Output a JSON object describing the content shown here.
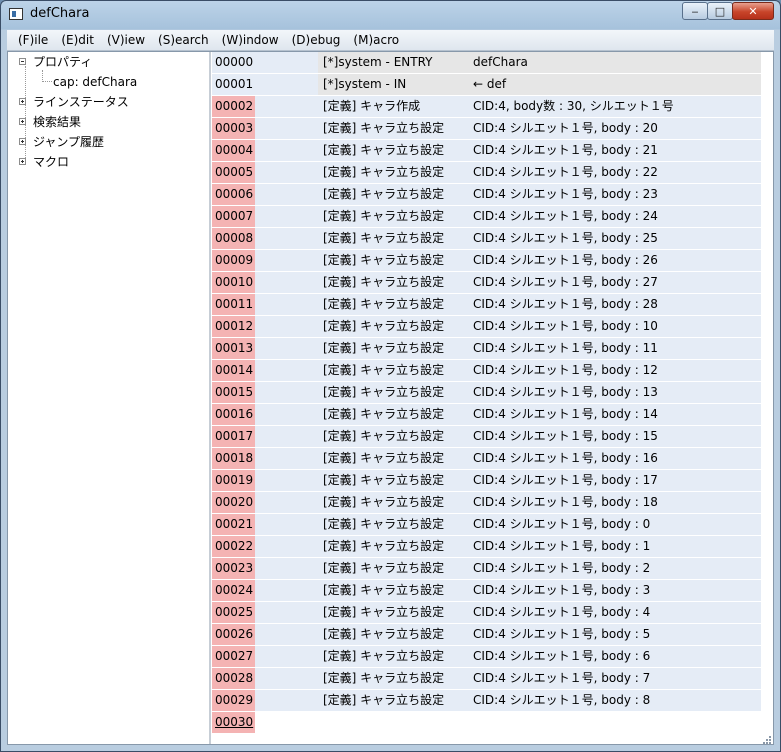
{
  "window": {
    "title": "defChara",
    "buttons": {
      "minimize": "‒",
      "maximize": "□",
      "close": "✕"
    }
  },
  "menu": [
    "(F)ile",
    "(E)dit",
    "(V)iew",
    "(S)earch",
    "(W)indow",
    "(D)ebug",
    "(M)acro"
  ],
  "tree": {
    "properties": "プロパティ",
    "cap": "cap: defChara",
    "line_status": "ラインステータス",
    "search_results": "検索結果",
    "jump_history": "ジャンプ履歴",
    "macro": "マクロ"
  },
  "rows": [
    {
      "num": "00000",
      "cmd": "[*]system -  ENTRY",
      "arg": "defChara",
      "kind": "sys"
    },
    {
      "num": "00001",
      "cmd": "[*]system -  IN",
      "arg": "← def",
      "kind": "sys"
    },
    {
      "num": "00002",
      "cmd": "[定義] キャラ作成",
      "arg": "CID:4, body数 : 30, シルエット１号",
      "kind": "def"
    },
    {
      "num": "00003",
      "cmd": "[定義] キャラ立ち設定",
      "arg": "CID:4 シルエット１号, body : 20",
      "kind": "def"
    },
    {
      "num": "00004",
      "cmd": "[定義] キャラ立ち設定",
      "arg": "CID:4 シルエット１号, body : 21",
      "kind": "def"
    },
    {
      "num": "00005",
      "cmd": "[定義] キャラ立ち設定",
      "arg": "CID:4 シルエット１号, body : 22",
      "kind": "def"
    },
    {
      "num": "00006",
      "cmd": "[定義] キャラ立ち設定",
      "arg": "CID:4 シルエット１号, body : 23",
      "kind": "def"
    },
    {
      "num": "00007",
      "cmd": "[定義] キャラ立ち設定",
      "arg": "CID:4 シルエット１号, body : 24",
      "kind": "def"
    },
    {
      "num": "00008",
      "cmd": "[定義] キャラ立ち設定",
      "arg": "CID:4 シルエット１号, body : 25",
      "kind": "def"
    },
    {
      "num": "00009",
      "cmd": "[定義] キャラ立ち設定",
      "arg": "CID:4 シルエット１号, body : 26",
      "kind": "def"
    },
    {
      "num": "00010",
      "cmd": "[定義] キャラ立ち設定",
      "arg": "CID:4 シルエット１号, body : 27",
      "kind": "def"
    },
    {
      "num": "00011",
      "cmd": "[定義] キャラ立ち設定",
      "arg": "CID:4 シルエット１号, body : 28",
      "kind": "def"
    },
    {
      "num": "00012",
      "cmd": "[定義] キャラ立ち設定",
      "arg": "CID:4 シルエット１号, body : 10",
      "kind": "def"
    },
    {
      "num": "00013",
      "cmd": "[定義] キャラ立ち設定",
      "arg": "CID:4 シルエット１号, body : 11",
      "kind": "def"
    },
    {
      "num": "00014",
      "cmd": "[定義] キャラ立ち設定",
      "arg": "CID:4 シルエット１号, body : 12",
      "kind": "def"
    },
    {
      "num": "00015",
      "cmd": "[定義] キャラ立ち設定",
      "arg": "CID:4 シルエット１号, body : 13",
      "kind": "def"
    },
    {
      "num": "00016",
      "cmd": "[定義] キャラ立ち設定",
      "arg": "CID:4 シルエット１号, body : 14",
      "kind": "def"
    },
    {
      "num": "00017",
      "cmd": "[定義] キャラ立ち設定",
      "arg": "CID:4 シルエット１号, body : 15",
      "kind": "def"
    },
    {
      "num": "00018",
      "cmd": "[定義] キャラ立ち設定",
      "arg": "CID:4 シルエット１号, body : 16",
      "kind": "def"
    },
    {
      "num": "00019",
      "cmd": "[定義] キャラ立ち設定",
      "arg": "CID:4 シルエット１号, body : 17",
      "kind": "def"
    },
    {
      "num": "00020",
      "cmd": "[定義] キャラ立ち設定",
      "arg": "CID:4 シルエット１号, body : 18",
      "kind": "def"
    },
    {
      "num": "00021",
      "cmd": "[定義] キャラ立ち設定",
      "arg": "CID:4 シルエット１号, body : 0",
      "kind": "def"
    },
    {
      "num": "00022",
      "cmd": "[定義] キャラ立ち設定",
      "arg": "CID:4 シルエット１号, body : 1",
      "kind": "def"
    },
    {
      "num": "00023",
      "cmd": "[定義] キャラ立ち設定",
      "arg": "CID:4 シルエット１号, body : 2",
      "kind": "def"
    },
    {
      "num": "00024",
      "cmd": "[定義] キャラ立ち設定",
      "arg": "CID:4 シルエット１号, body : 3",
      "kind": "def"
    },
    {
      "num": "00025",
      "cmd": "[定義] キャラ立ち設定",
      "arg": "CID:4 シルエット１号, body : 4",
      "kind": "def"
    },
    {
      "num": "00026",
      "cmd": "[定義] キャラ立ち設定",
      "arg": "CID:4 シルエット１号, body : 5",
      "kind": "def"
    },
    {
      "num": "00027",
      "cmd": "[定義] キャラ立ち設定",
      "arg": "CID:4 シルエット１号, body : 6",
      "kind": "def"
    },
    {
      "num": "00028",
      "cmd": "[定義] キャラ立ち設定",
      "arg": "CID:4 シルエット１号, body : 7",
      "kind": "def"
    },
    {
      "num": "00029",
      "cmd": "[定義] キャラ立ち設定",
      "arg": "CID:4 シルエット１号, body : 8",
      "kind": "def"
    },
    {
      "num": "00030",
      "cmd": "",
      "arg": "",
      "kind": "cur"
    }
  ],
  "colors": {
    "line_number_highlight": "#f4b3b3",
    "row_background": "#e5ecf6",
    "system_row": "#e6e6e6"
  }
}
